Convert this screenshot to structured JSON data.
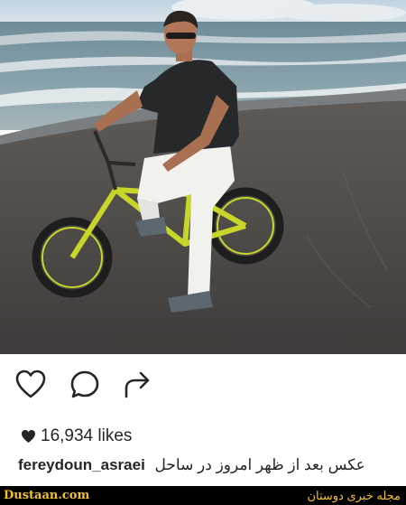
{
  "post": {
    "likes": "16,934 likes",
    "username": "fereydoun_asraei",
    "caption": "عکس بعد از ظهر امروز در ساحل"
  },
  "icons": {
    "like": "heart-outline-icon",
    "comment": "speech-bubble-icon",
    "share": "share-arrow-icon",
    "likes_heart": "heart-filled-icon"
  },
  "footer": {
    "left_text": "Dustaan.com",
    "right_text": "مجله خبری دوستان"
  },
  "colors": {
    "text": "#262626",
    "footer_bg": "#000000",
    "footer_text": "#f2c12e",
    "bike_frame": "#c8d62a"
  }
}
